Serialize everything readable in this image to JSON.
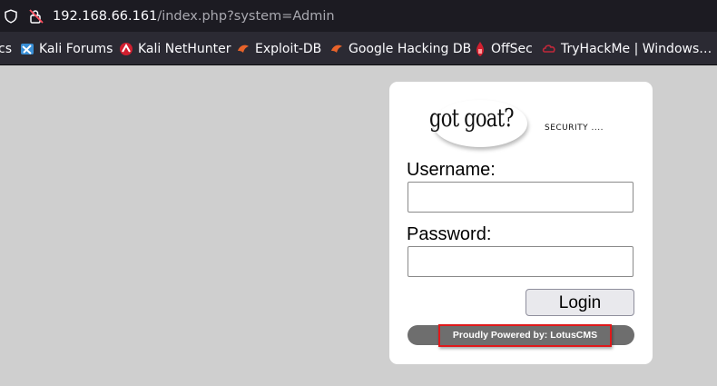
{
  "browser": {
    "url_host": "192.168.66.161",
    "url_path": "/index.php?system=Admin",
    "bookmarks": [
      {
        "label": "cs",
        "icon": "partial-bookmark-icon"
      },
      {
        "label": "Kali Forums",
        "icon": "kali-forums-icon"
      },
      {
        "label": "Kali NetHunter",
        "icon": "kali-nethunter-icon"
      },
      {
        "label": "Exploit-DB",
        "icon": "exploit-db-icon"
      },
      {
        "label": "Google Hacking DB",
        "icon": "google-hacking-db-icon"
      },
      {
        "label": "OffSec",
        "icon": "offsec-icon"
      },
      {
        "label": "TryHackMe | Windows…",
        "icon": "tryhackme-icon"
      }
    ]
  },
  "login": {
    "logo_text": "got goat?",
    "tagline": "SECURITY ....",
    "username_label": "Username:",
    "username_value": "",
    "password_label": "Password:",
    "password_value": "",
    "login_button": "Login",
    "footer_text": "Proudly Powered by: LotusCMS"
  },
  "colors": {
    "page_background": "#cfcfcf",
    "panel_background": "#ffffff",
    "footer_bar": "#6e6e6e",
    "highlight_box": "#e0191b",
    "toolbar": "#1c1b22",
    "bookmarks_bar": "#2b2a33"
  }
}
